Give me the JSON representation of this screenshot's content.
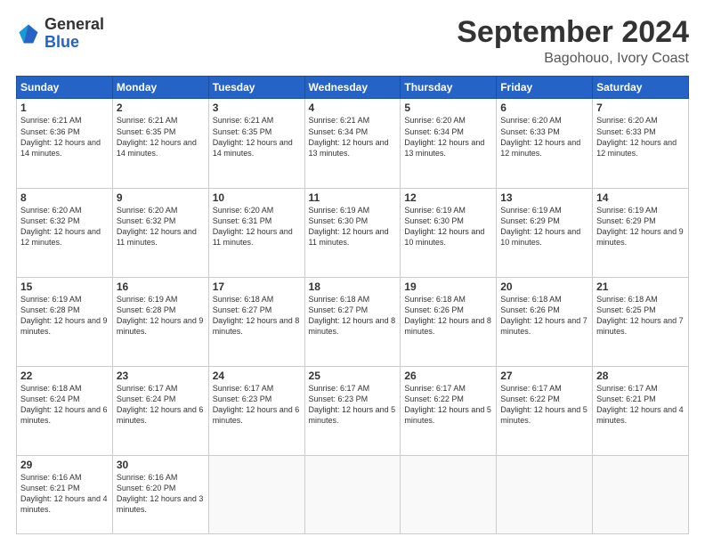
{
  "logo": {
    "general": "General",
    "blue": "Blue"
  },
  "header": {
    "month": "September 2024",
    "location": "Bagohouo, Ivory Coast"
  },
  "weekdays": [
    "Sunday",
    "Monday",
    "Tuesday",
    "Wednesday",
    "Thursday",
    "Friday",
    "Saturday"
  ],
  "weeks": [
    [
      {
        "day": "1",
        "sunrise": "6:21 AM",
        "sunset": "6:36 PM",
        "daylight": "12 hours and 14 minutes."
      },
      {
        "day": "2",
        "sunrise": "6:21 AM",
        "sunset": "6:35 PM",
        "daylight": "12 hours and 14 minutes."
      },
      {
        "day": "3",
        "sunrise": "6:21 AM",
        "sunset": "6:35 PM",
        "daylight": "12 hours and 14 minutes."
      },
      {
        "day": "4",
        "sunrise": "6:21 AM",
        "sunset": "6:34 PM",
        "daylight": "12 hours and 13 minutes."
      },
      {
        "day": "5",
        "sunrise": "6:20 AM",
        "sunset": "6:34 PM",
        "daylight": "12 hours and 13 minutes."
      },
      {
        "day": "6",
        "sunrise": "6:20 AM",
        "sunset": "6:33 PM",
        "daylight": "12 hours and 12 minutes."
      },
      {
        "day": "7",
        "sunrise": "6:20 AM",
        "sunset": "6:33 PM",
        "daylight": "12 hours and 12 minutes."
      }
    ],
    [
      {
        "day": "8",
        "sunrise": "6:20 AM",
        "sunset": "6:32 PM",
        "daylight": "12 hours and 12 minutes."
      },
      {
        "day": "9",
        "sunrise": "6:20 AM",
        "sunset": "6:32 PM",
        "daylight": "12 hours and 11 minutes."
      },
      {
        "day": "10",
        "sunrise": "6:20 AM",
        "sunset": "6:31 PM",
        "daylight": "12 hours and 11 minutes."
      },
      {
        "day": "11",
        "sunrise": "6:19 AM",
        "sunset": "6:30 PM",
        "daylight": "12 hours and 11 minutes."
      },
      {
        "day": "12",
        "sunrise": "6:19 AM",
        "sunset": "6:30 PM",
        "daylight": "12 hours and 10 minutes."
      },
      {
        "day": "13",
        "sunrise": "6:19 AM",
        "sunset": "6:29 PM",
        "daylight": "12 hours and 10 minutes."
      },
      {
        "day": "14",
        "sunrise": "6:19 AM",
        "sunset": "6:29 PM",
        "daylight": "12 hours and 9 minutes."
      }
    ],
    [
      {
        "day": "15",
        "sunrise": "6:19 AM",
        "sunset": "6:28 PM",
        "daylight": "12 hours and 9 minutes."
      },
      {
        "day": "16",
        "sunrise": "6:19 AM",
        "sunset": "6:28 PM",
        "daylight": "12 hours and 9 minutes."
      },
      {
        "day": "17",
        "sunrise": "6:18 AM",
        "sunset": "6:27 PM",
        "daylight": "12 hours and 8 minutes."
      },
      {
        "day": "18",
        "sunrise": "6:18 AM",
        "sunset": "6:27 PM",
        "daylight": "12 hours and 8 minutes."
      },
      {
        "day": "19",
        "sunrise": "6:18 AM",
        "sunset": "6:26 PM",
        "daylight": "12 hours and 8 minutes."
      },
      {
        "day": "20",
        "sunrise": "6:18 AM",
        "sunset": "6:26 PM",
        "daylight": "12 hours and 7 minutes."
      },
      {
        "day": "21",
        "sunrise": "6:18 AM",
        "sunset": "6:25 PM",
        "daylight": "12 hours and 7 minutes."
      }
    ],
    [
      {
        "day": "22",
        "sunrise": "6:18 AM",
        "sunset": "6:24 PM",
        "daylight": "12 hours and 6 minutes."
      },
      {
        "day": "23",
        "sunrise": "6:17 AM",
        "sunset": "6:24 PM",
        "daylight": "12 hours and 6 minutes."
      },
      {
        "day": "24",
        "sunrise": "6:17 AM",
        "sunset": "6:23 PM",
        "daylight": "12 hours and 6 minutes."
      },
      {
        "day": "25",
        "sunrise": "6:17 AM",
        "sunset": "6:23 PM",
        "daylight": "12 hours and 5 minutes."
      },
      {
        "day": "26",
        "sunrise": "6:17 AM",
        "sunset": "6:22 PM",
        "daylight": "12 hours and 5 minutes."
      },
      {
        "day": "27",
        "sunrise": "6:17 AM",
        "sunset": "6:22 PM",
        "daylight": "12 hours and 5 minutes."
      },
      {
        "day": "28",
        "sunrise": "6:17 AM",
        "sunset": "6:21 PM",
        "daylight": "12 hours and 4 minutes."
      }
    ],
    [
      {
        "day": "29",
        "sunrise": "6:16 AM",
        "sunset": "6:21 PM",
        "daylight": "12 hours and 4 minutes."
      },
      {
        "day": "30",
        "sunrise": "6:16 AM",
        "sunset": "6:20 PM",
        "daylight": "12 hours and 3 minutes."
      },
      null,
      null,
      null,
      null,
      null
    ]
  ],
  "labels": {
    "sunrise": "Sunrise:",
    "sunset": "Sunset:",
    "daylight": "Daylight:"
  }
}
